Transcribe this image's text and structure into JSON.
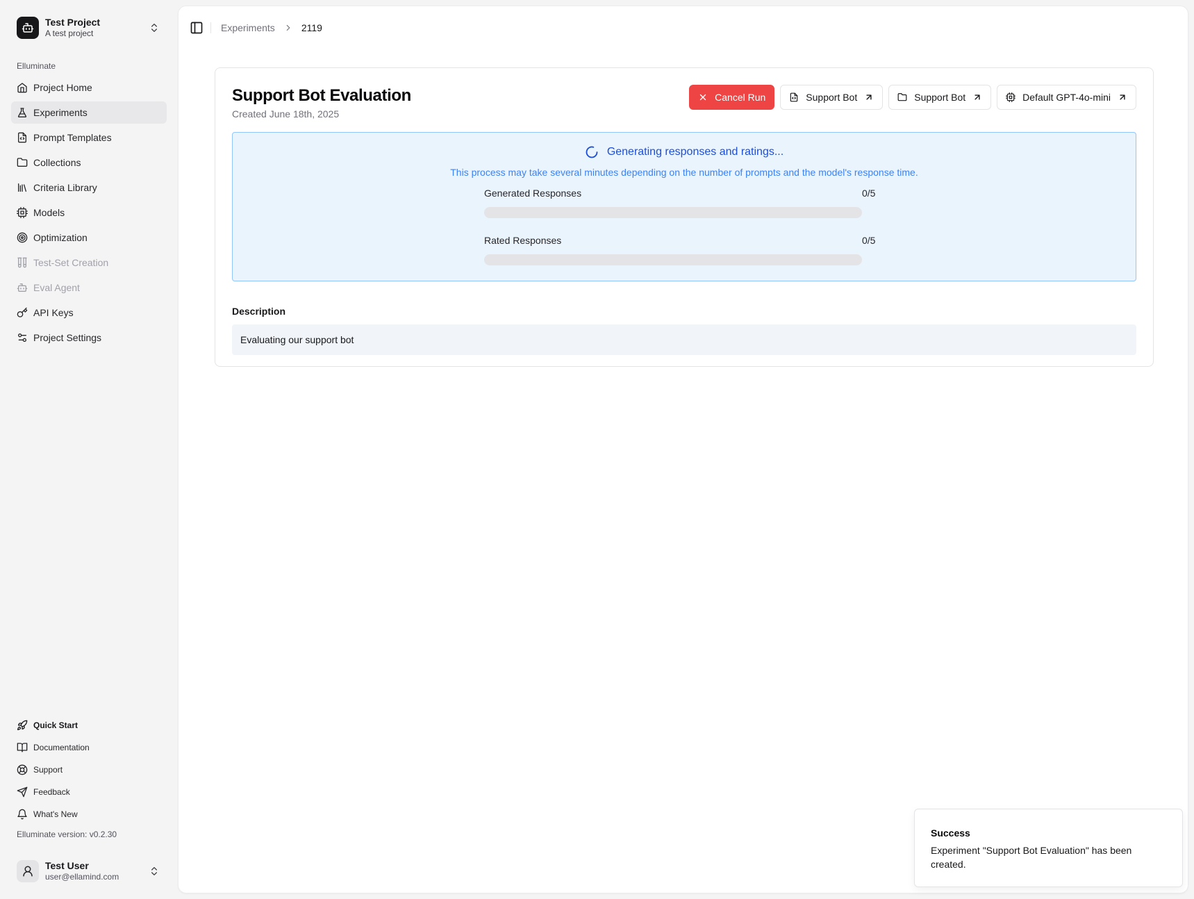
{
  "project": {
    "name": "Test Project",
    "subtitle": "A test project"
  },
  "sidebar": {
    "group_label": "Elluminate",
    "items": [
      {
        "label": "Project Home",
        "icon": "home-icon",
        "active": false,
        "disabled": false
      },
      {
        "label": "Experiments",
        "icon": "flask-icon",
        "active": true,
        "disabled": false
      },
      {
        "label": "Prompt Templates",
        "icon": "file-code-icon",
        "active": false,
        "disabled": false
      },
      {
        "label": "Collections",
        "icon": "folder-icon",
        "active": false,
        "disabled": false
      },
      {
        "label": "Criteria Library",
        "icon": "library-icon",
        "active": false,
        "disabled": false
      },
      {
        "label": "Models",
        "icon": "cpu-icon",
        "active": false,
        "disabled": false
      },
      {
        "label": "Optimization",
        "icon": "target-icon",
        "active": false,
        "disabled": false
      },
      {
        "label": "Test-Set Creation",
        "icon": "test-tubes-icon",
        "active": false,
        "disabled": true
      },
      {
        "label": "Eval Agent",
        "icon": "bot-icon",
        "active": false,
        "disabled": true
      },
      {
        "label": "API Keys",
        "icon": "key-icon",
        "active": false,
        "disabled": false
      },
      {
        "label": "Project Settings",
        "icon": "sliders-icon",
        "active": false,
        "disabled": false
      }
    ],
    "bottom": [
      {
        "label": "Quick Start",
        "icon": "rocket-icon"
      },
      {
        "label": "Documentation",
        "icon": "book-icon"
      },
      {
        "label": "Support",
        "icon": "life-buoy-icon"
      },
      {
        "label": "Feedback",
        "icon": "send-icon"
      },
      {
        "label": "What's New",
        "icon": "bell-icon"
      }
    ],
    "version": "Elluminate version: v0.2.30"
  },
  "user": {
    "name": "Test User",
    "email": "user@ellamind.com"
  },
  "breadcrumb": {
    "parent": "Experiments",
    "current": "2119"
  },
  "experiment": {
    "title": "Support Bot Evaluation",
    "created": "Created June 18th, 2025",
    "actions": {
      "cancel": "Cancel Run",
      "prompt_template": "Support Bot",
      "collection": "Support Bot",
      "model": "Default GPT-4o-mini"
    },
    "progress": {
      "title": "Generating responses and ratings...",
      "note": "This process may take several minutes depending on the number of prompts and the model's response time.",
      "generated": {
        "label": "Generated Responses",
        "count": "0/5",
        "fraction": 0
      },
      "rated": {
        "label": "Rated Responses",
        "count": "0/5",
        "fraction": 0
      }
    },
    "description_label": "Description",
    "description": "Evaluating our support bot"
  },
  "toast": {
    "title": "Success",
    "message": "Experiment \"Support Bot Evaluation\" has been created."
  },
  "colors": {
    "accent": "#3b82f6",
    "danger": "#ef4444",
    "progress_bg": "#eaf4fd",
    "progress_border": "#93c5fd"
  }
}
